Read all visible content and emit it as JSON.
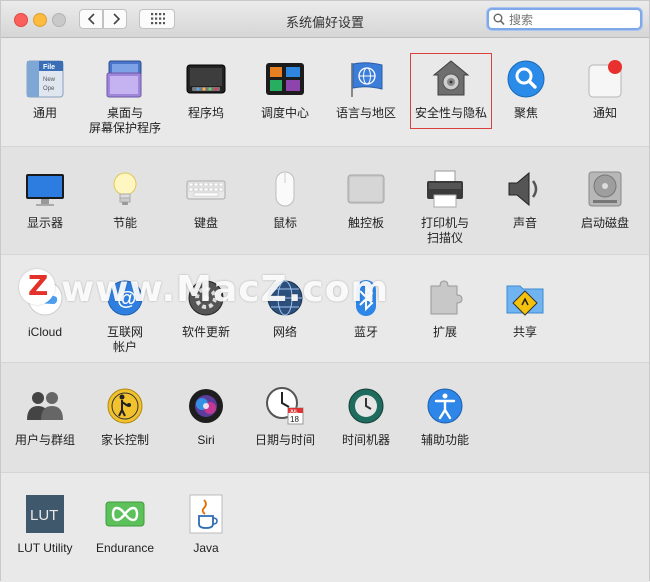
{
  "window": {
    "title": "系统偏好设置",
    "search_placeholder": "搜索"
  },
  "rows": [
    {
      "panes": [
        {
          "id": "general",
          "label": "通用",
          "icon": "general-icon"
        },
        {
          "id": "desktop",
          "label": "桌面与\n屏幕保护程序",
          "icon": "desktop-screensaver-icon"
        },
        {
          "id": "dock",
          "label": "程序坞",
          "icon": "dock-icon"
        },
        {
          "id": "mission",
          "label": "调度中心",
          "icon": "mission-control-icon"
        },
        {
          "id": "language",
          "label": "语言与地区",
          "icon": "language-region-icon"
        },
        {
          "id": "security",
          "label": "安全性与隐私",
          "icon": "security-privacy-icon",
          "highlighted": true
        },
        {
          "id": "spotlight",
          "label": "聚焦",
          "icon": "spotlight-icon"
        },
        {
          "id": "notifications",
          "label": "通知",
          "icon": "notifications-icon"
        }
      ]
    },
    {
      "panes": [
        {
          "id": "displays",
          "label": "显示器",
          "icon": "display-icon"
        },
        {
          "id": "energy",
          "label": "节能",
          "icon": "energy-saver-icon"
        },
        {
          "id": "keyboard",
          "label": "键盘",
          "icon": "keyboard-icon"
        },
        {
          "id": "mouse",
          "label": "鼠标",
          "icon": "mouse-icon"
        },
        {
          "id": "trackpad",
          "label": "触控板",
          "icon": "trackpad-icon"
        },
        {
          "id": "printers",
          "label": "打印机与\n扫描仪",
          "icon": "printer-icon"
        },
        {
          "id": "sound",
          "label": "声音",
          "icon": "sound-icon"
        },
        {
          "id": "startup",
          "label": "启动磁盘",
          "icon": "startup-disk-icon"
        }
      ]
    },
    {
      "panes": [
        {
          "id": "icloud",
          "label": "iCloud",
          "icon": "icloud-icon"
        },
        {
          "id": "internet",
          "label": "互联网\n帐户",
          "icon": "internet-accounts-icon"
        },
        {
          "id": "update",
          "label": "软件更新",
          "icon": "software-update-icon"
        },
        {
          "id": "network",
          "label": "网络",
          "icon": "network-icon"
        },
        {
          "id": "bluetooth",
          "label": "蓝牙",
          "icon": "bluetooth-icon"
        },
        {
          "id": "extensions",
          "label": "扩展",
          "icon": "extensions-icon"
        },
        {
          "id": "sharing",
          "label": "共享",
          "icon": "sharing-icon"
        }
      ]
    },
    {
      "panes": [
        {
          "id": "users",
          "label": "用户与群组",
          "icon": "users-groups-icon"
        },
        {
          "id": "parental",
          "label": "家长控制",
          "icon": "parental-controls-icon"
        },
        {
          "id": "siri",
          "label": "Siri",
          "icon": "siri-icon"
        },
        {
          "id": "datetime",
          "label": "日期与时间",
          "icon": "date-time-icon"
        },
        {
          "id": "timemachine",
          "label": "时间机器",
          "icon": "time-machine-icon"
        },
        {
          "id": "accessibility",
          "label": "辅助功能",
          "icon": "accessibility-icon"
        }
      ]
    },
    {
      "panes": [
        {
          "id": "lut",
          "label": "LUT Utility",
          "icon": "lut-utility-icon"
        },
        {
          "id": "endurance",
          "label": "Endurance",
          "icon": "endurance-icon"
        },
        {
          "id": "java",
          "label": "Java",
          "icon": "java-icon"
        }
      ]
    }
  ],
  "icon_text": {
    "general_file": "File",
    "general_new": "New",
    "general_ope": "Ope",
    "lut": "LUT",
    "calendar_month": "JUL",
    "calendar_day": "18"
  },
  "watermark": {
    "text": "www.MacZ.com",
    "logo_letter": "Z"
  },
  "colors": {
    "highlight_border": "#d9413f",
    "search_focus": "#7ea8e8"
  }
}
